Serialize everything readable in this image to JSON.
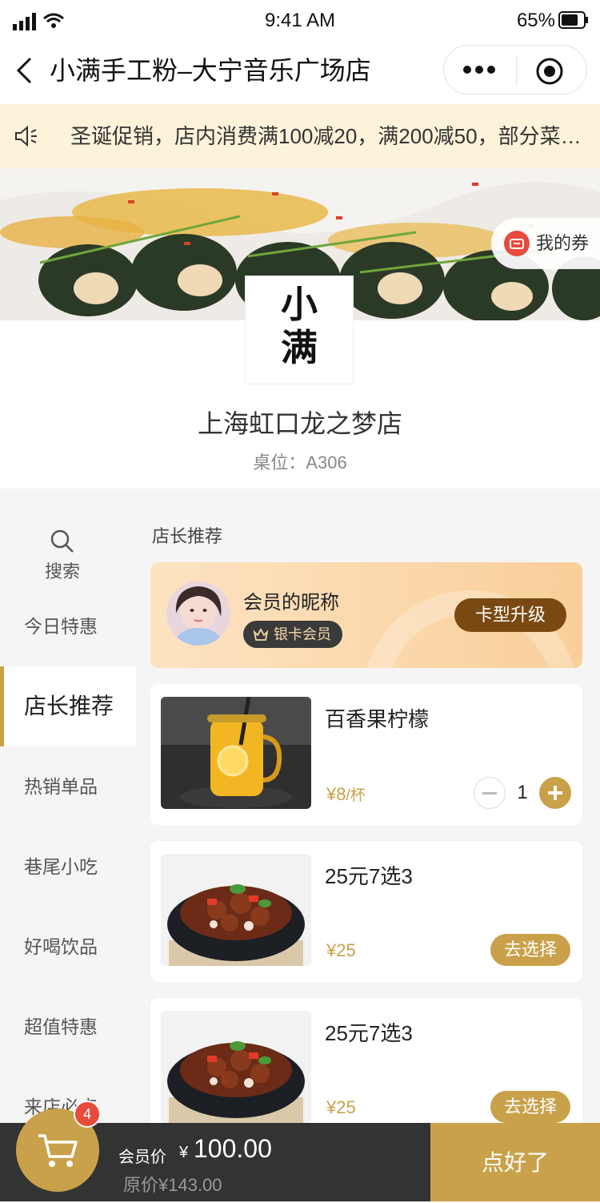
{
  "status_bar": {
    "time": "9:41 AM",
    "battery": "65%"
  },
  "nav": {
    "title": "小满手工粉–大宁音乐广场店"
  },
  "notice": {
    "text": "圣诞促销，店内消费满100减20，满200减50，部分菜…"
  },
  "banner": {
    "coupon_label": "我的券"
  },
  "store": {
    "logo_line1": "小",
    "logo_line2": "满",
    "name": "上海虹口龙之梦店",
    "table": "桌位：A306"
  },
  "sidebar": {
    "search_label": "搜索",
    "categories": [
      {
        "label": "今日特惠"
      },
      {
        "label": "店长推荐"
      },
      {
        "label": "热销单品"
      },
      {
        "label": "巷尾小吃"
      },
      {
        "label": "好喝饮品"
      },
      {
        "label": "超值特惠"
      },
      {
        "label": "来店必点"
      }
    ]
  },
  "main": {
    "section_title": "店长推荐",
    "member": {
      "nickname": "会员的昵称",
      "level": "银卡会员",
      "upgrade_label": "卡型升级"
    },
    "dishes": [
      {
        "name": "百香果柠檬",
        "price": "¥8",
        "unit": "/杯",
        "quantity": "1"
      },
      {
        "name": "25元7选3",
        "price": "¥25",
        "action": "去选择"
      },
      {
        "name": "25元7选3",
        "price": "¥25",
        "action": "去选择"
      }
    ]
  },
  "cart": {
    "count": "4",
    "member_price_label": "会员价",
    "currency": "¥",
    "member_price": "100.00",
    "original_price": "原价¥143.00",
    "checkout_label": "点好了"
  },
  "colors": {
    "accent": "#c9a14a",
    "notice_bg": "#fcf3da",
    "bottom_bar": "#333333",
    "upgrade_button": "#7a4912"
  }
}
